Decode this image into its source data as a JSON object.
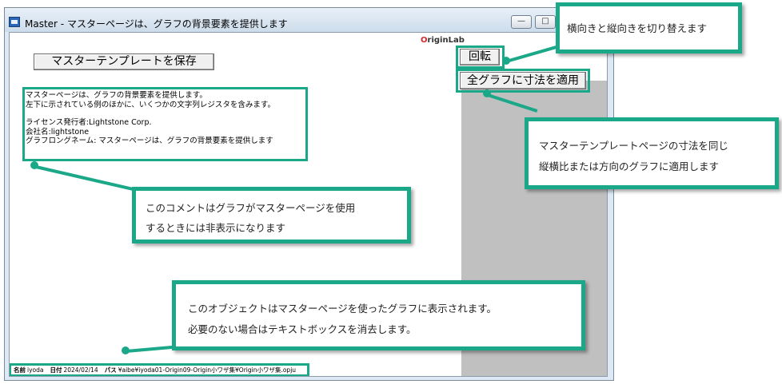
{
  "window": {
    "title": "Master - マスターページは、グラフの背景要素を提供します",
    "minimize_glyph": "—",
    "maximize_glyph": "□"
  },
  "logo": {
    "first": "O",
    "rest": "riginLab"
  },
  "buttons": {
    "save_template": "マスターテンプレートを保存",
    "rotate": "回転",
    "apply_size": "全グラフに寸法を適用"
  },
  "comment": {
    "line1": "マスターページは、グラフの背景要素を提供します。",
    "line2": "左下に示されている例のほかに、いくつかの文字列レジスタを含みます。",
    "line3": "ライセンス発行者:Lightstone Corp.",
    "line4": "会社名:lightstone",
    "line5": "グラフロングネーム: マスターページは、グラフの背景要素を提供します"
  },
  "footer": {
    "name_label": "名前",
    "name_value": "iyoda",
    "date_label": "日付",
    "date_value": "2024/02/14",
    "path_label": "パス",
    "path_value": "¥aibe¥iyoda01-Origin09-Origin小ワザ集¥Origin小ワザ集.opju"
  },
  "callouts": {
    "rotate": {
      "line1": "横向きと縦向きを切り替えます"
    },
    "apply": {
      "line1": "マスターテンプレートページの寸法を同じ",
      "line2": "縦横比または方向のグラフに適用します"
    },
    "comment": {
      "line1": "このコメントはグラフがマスターページを使用",
      "line2": "するときには非表示になります"
    },
    "object": {
      "line1": "このオブジェクトはマスターページを使ったグラフに表示されます。",
      "line2": "必要のない場合はテキストボックスを消去します。"
    }
  },
  "colors": {
    "accent": "#1aa889",
    "panel_gray": "#c0c0c0",
    "logo_red": "#d62828"
  }
}
